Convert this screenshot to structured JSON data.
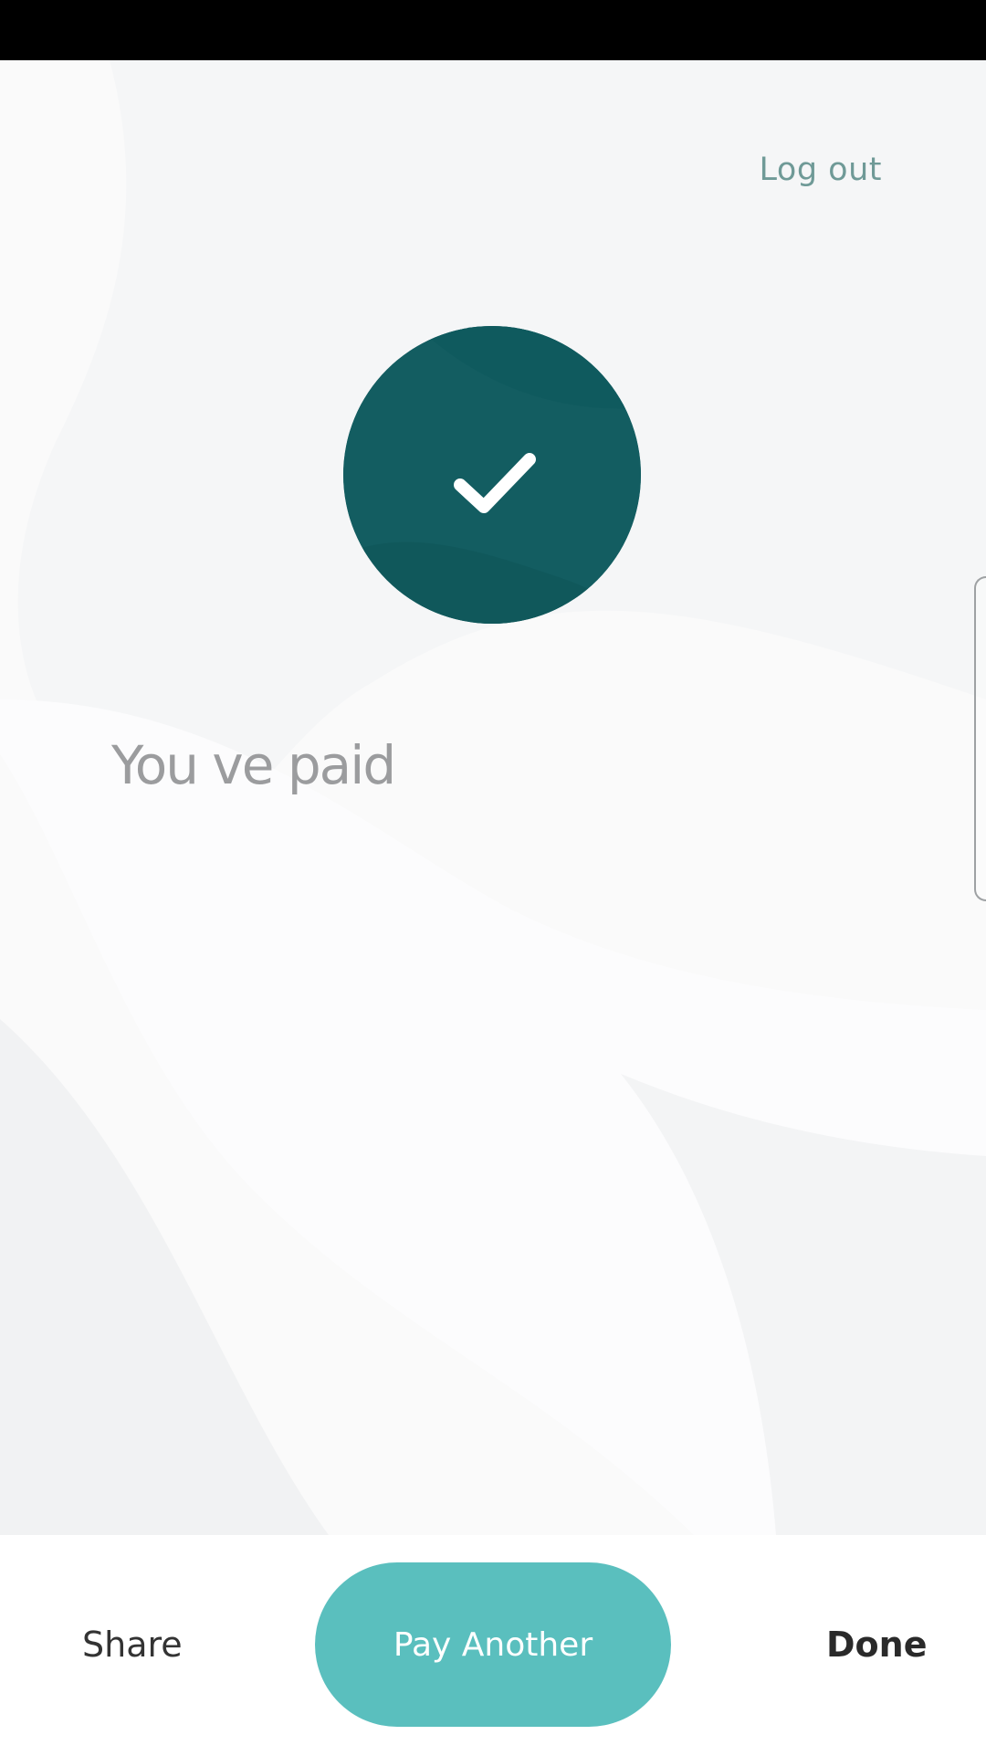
{
  "header": {
    "logout_label": "Log out"
  },
  "status": {
    "icon": "check-icon",
    "title": "You ve paid"
  },
  "actions": {
    "share_label": "Share",
    "pay_another_label": "Pay Another",
    "done_label": "Done"
  },
  "colors": {
    "accent": "#135d61",
    "button": "#5abfbe",
    "link": "#6f9a97",
    "muted_text": "#9b9c9e"
  }
}
